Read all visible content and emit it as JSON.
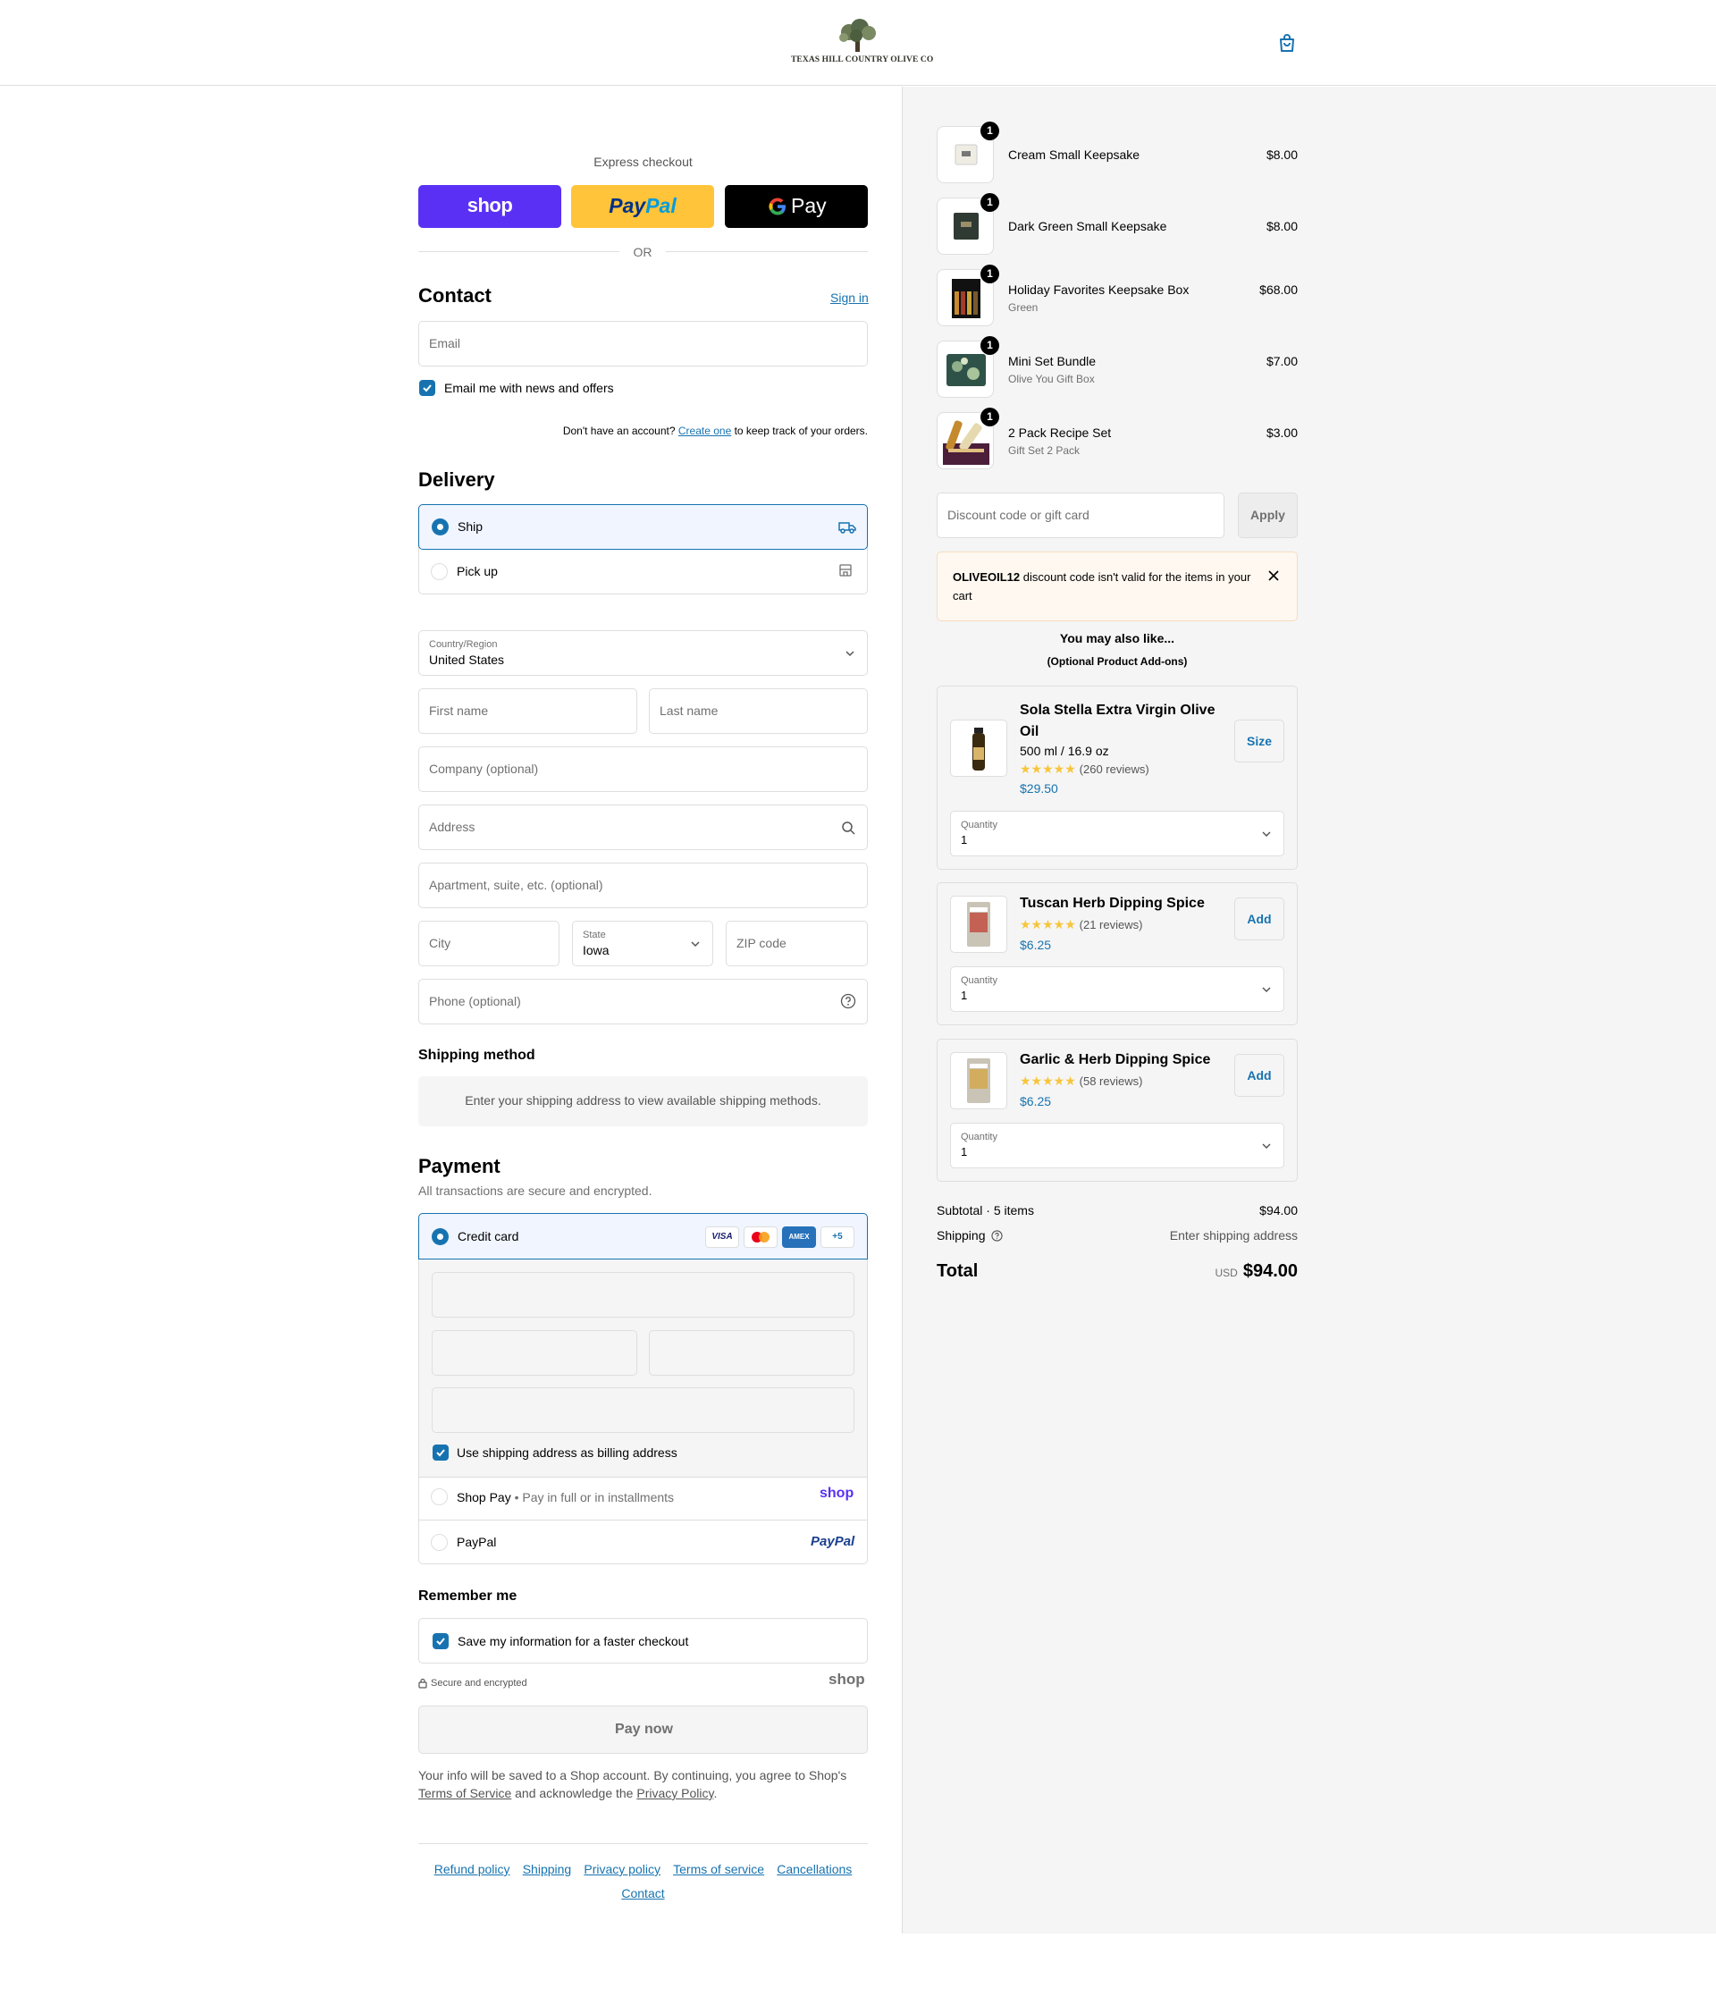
{
  "header": {
    "brand": "TEXAS HILL COUNTRY OLIVE CO"
  },
  "express": {
    "title": "Express checkout",
    "shop_label": "shop",
    "paypal_label_1": "Pay",
    "paypal_label_2": "Pal",
    "gpay_label": "Pay",
    "or": "OR"
  },
  "contact": {
    "title": "Contact",
    "sign_in": "Sign in",
    "email_placeholder": "Email",
    "newsletter_label": "Email me with news and offers",
    "no_account_prefix": "Don't have an account?",
    "create_one": "Create one",
    "no_account_suffix": "to keep track of your orders."
  },
  "delivery": {
    "title": "Delivery",
    "ship_label": "Ship",
    "pickup_label": "Pick up",
    "country_label": "Country/Region",
    "country_value": "United States",
    "first_name": "First name",
    "last_name": "Last name",
    "company": "Company (optional)",
    "address": "Address",
    "apartment": "Apartment, suite, etc. (optional)",
    "city": "City",
    "state_label": "State",
    "state_value": "Iowa",
    "zip": "ZIP code",
    "phone": "Phone (optional)"
  },
  "shipping_method": {
    "title": "Shipping method",
    "notice": "Enter your shipping address to view available shipping methods."
  },
  "payment": {
    "title": "Payment",
    "subtitle": "All transactions are secure and encrypted.",
    "credit_card": "Credit card",
    "card_brands": [
      "VISA",
      "MC",
      "AMEX"
    ],
    "more_cards": "+5",
    "billing_same": "Use shipping address as billing address",
    "shop_pay": "Shop Pay",
    "shop_pay_sub": "Pay in full or in installments",
    "shop_logo": "shop",
    "paypal": "PayPal",
    "paypal_logo": "PayPal"
  },
  "remember": {
    "title": "Remember me",
    "save_label": "Save my information for a faster checkout",
    "secure": "Secure and encrypted",
    "shop_logo": "shop"
  },
  "pay_now": "Pay now",
  "legal": {
    "line1": "Your info will be saved to a Shop account. By continuing, you agree to Shop's",
    "tos": "Terms of Service",
    "mid": "and acknowledge the",
    "privacy": "Privacy Policy",
    "end": "."
  },
  "footer_links": [
    "Refund policy",
    "Shipping",
    "Privacy policy",
    "Terms of service",
    "Cancellations",
    "Contact"
  ],
  "cart_items": [
    {
      "qty": "1",
      "title": "Cream Small Keepsake",
      "variant": "",
      "price": "$8.00"
    },
    {
      "qty": "1",
      "title": "Dark Green Small Keepsake",
      "variant": "",
      "price": "$8.00"
    },
    {
      "qty": "1",
      "title": "Holiday Favorites Keepsake Box",
      "variant": "Green",
      "price": "$68.00"
    },
    {
      "qty": "1",
      "title": "Mini Set Bundle",
      "variant": "Olive You Gift Box",
      "price": "$7.00"
    },
    {
      "qty": "1",
      "title": "2 Pack Recipe Set",
      "variant": "Gift Set 2 Pack",
      "price": "$3.00"
    }
  ],
  "discount": {
    "placeholder": "Discount code or gift card",
    "apply": "Apply",
    "error_code": "OLIVEOIL12",
    "error_text": " discount code isn't valid for the items in your cart"
  },
  "upsell": {
    "title": "You may also like...",
    "subtitle": "(Optional Product Add-ons)",
    "items": [
      {
        "name": "Sola Stella Extra Virgin Olive Oil",
        "size": "500 ml / 16.9 oz",
        "stars": "★★★★★",
        "rating": 5,
        "reviews": "(260 reviews)",
        "price": "$29.50",
        "button": "Size",
        "qty_label": "Quantity",
        "qty": "1"
      },
      {
        "name": "Tuscan Herb Dipping Spice",
        "size": "",
        "stars": "★★★★★",
        "rating": 5,
        "reviews": "(21 reviews)",
        "price": "$6.25",
        "button": "Add",
        "qty_label": "Quantity",
        "qty": "1"
      },
      {
        "name": "Garlic & Herb Dipping Spice",
        "size": "",
        "stars": "★★★★★",
        "rating": 5,
        "reviews": "(58 reviews)",
        "price": "$6.25",
        "button": "Add",
        "qty_label": "Quantity",
        "qty": "1"
      }
    ]
  },
  "totals": {
    "subtotal_label": "Subtotal · 5 items",
    "subtotal": "$94.00",
    "shipping_label": "Shipping",
    "shipping_value": "Enter shipping address",
    "total_label": "Total",
    "currency": "USD",
    "total": "$94.00"
  },
  "colors": {
    "accent": "#1773b0",
    "shop_purple": "#5a31f4",
    "paypal_yellow": "#ffc439",
    "star": "#f7c53c",
    "error_bg": "#fff8f0"
  }
}
